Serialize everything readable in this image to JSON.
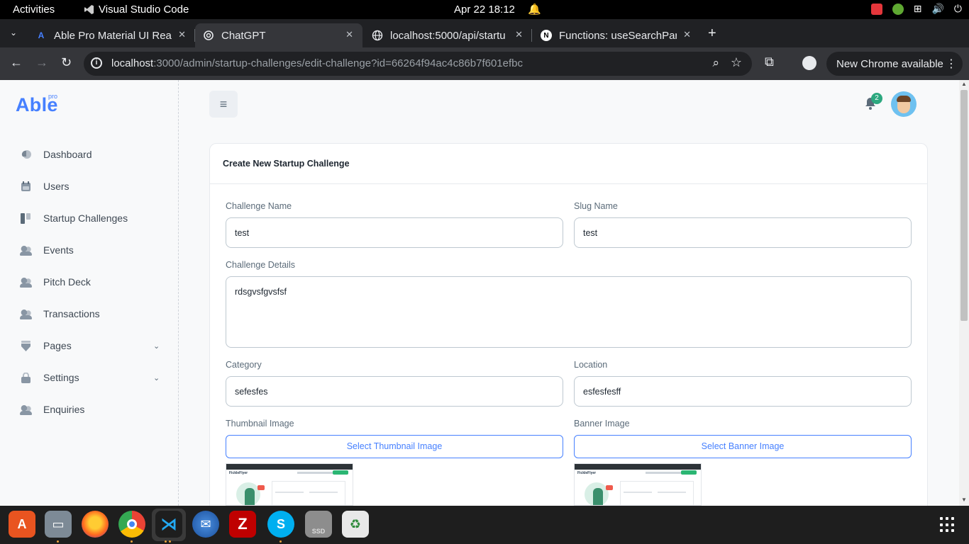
{
  "system": {
    "activities": "Activities",
    "app_name": "Visual Studio Code",
    "clock": "Apr 22  18:12"
  },
  "browser": {
    "tabs": [
      {
        "title": "Able Pro Material UI Rea",
        "favicon": "A"
      },
      {
        "title": "ChatGPT",
        "favicon": "chatgpt-icon"
      },
      {
        "title": "localhost:5000/api/startu",
        "favicon": "globe-icon"
      },
      {
        "title": "Functions: useSearchPar",
        "favicon": "N"
      }
    ],
    "url_host": "localhost",
    "url_path": ":3000/admin/startup-challenges/edit-challenge?id=66264f94ac4c86b7f601efbc",
    "update_label": "New Chrome available"
  },
  "app": {
    "logo": "Able",
    "logo_sup": "pro",
    "notification_count": "2",
    "sidebar": [
      {
        "label": "Dashboard",
        "icon": "dashboard-icon"
      },
      {
        "label": "Users",
        "icon": "users-icon"
      },
      {
        "label": "Startup Challenges",
        "icon": "challenges-icon"
      },
      {
        "label": "Events",
        "icon": "people-icon"
      },
      {
        "label": "Pitch Deck",
        "icon": "people-icon"
      },
      {
        "label": "Transactions",
        "icon": "people-icon"
      },
      {
        "label": "Pages",
        "icon": "pages-icon",
        "expandable": true
      },
      {
        "label": "Settings",
        "icon": "lock-icon",
        "expandable": true
      },
      {
        "label": "Enquiries",
        "icon": "people-icon"
      }
    ]
  },
  "form": {
    "title": "Create New Startup Challenge",
    "challenge_name_label": "Challenge Name",
    "challenge_name_value": "test",
    "slug_name_label": "Slug Name",
    "slug_name_value": "test",
    "challenge_details_label": "Challenge Details",
    "challenge_details_value": "rdsgvsfgvsfsf",
    "category_label": "Category",
    "category_value": "sefesfes",
    "location_label": "Location",
    "location_value": "esfesfesff",
    "thumbnail_label": "Thumbnail Image",
    "thumbnail_button": "Select Thumbnail Image",
    "banner_label": "Banner Image",
    "banner_button": "Select Banner Image"
  },
  "dock": [
    "app-center",
    "files",
    "firefox",
    "chrome",
    "vscode",
    "thunderbird",
    "filezilla",
    "skype",
    "disk",
    "trash"
  ],
  "colors": {
    "primary": "#4680ff",
    "badge": "#2ca87f",
    "text": "#1d2630",
    "muted": "#5b6b79"
  }
}
